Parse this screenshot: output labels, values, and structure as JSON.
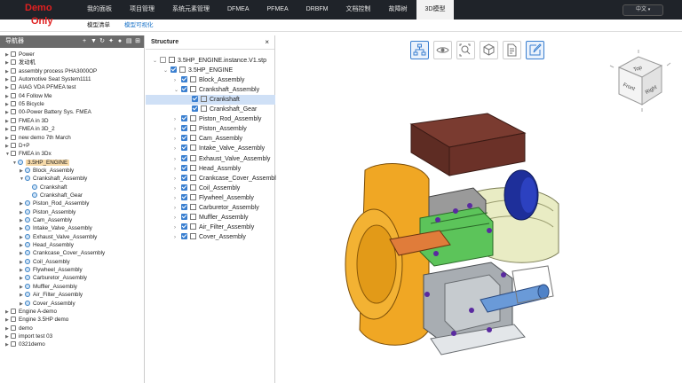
{
  "watermark": {
    "line1": "Demo",
    "line2": "Only"
  },
  "nav": [
    "我的面板",
    "项目管理",
    "系统元素管理",
    "DFMEA",
    "PFMEA",
    "DRBFM",
    "文档控制",
    "故障树",
    "3D模型"
  ],
  "language": "中文",
  "subtabs": [
    "模型清单",
    "模型可视化"
  ],
  "navigator": {
    "title": "导航器",
    "items": [
      {
        "label": "Power",
        "depth": 0
      },
      {
        "label": "发动机",
        "depth": 0
      },
      {
        "label": "assembly process PHA3000OP",
        "depth": 0
      },
      {
        "label": "Automotive Seat System1111",
        "depth": 0
      },
      {
        "label": "AIAG VDA PFMEA test",
        "depth": 0
      },
      {
        "label": "04 Follow Me",
        "depth": 0
      },
      {
        "label": "05 Bicycle",
        "depth": 0
      },
      {
        "label": "00-Power Battery Sys. FMEA",
        "depth": 0
      },
      {
        "label": "FMEA in 3D",
        "depth": 0
      },
      {
        "label": "FMEA in 3D_2",
        "depth": 0
      },
      {
        "label": "new demo 7th March",
        "depth": 0
      },
      {
        "label": "D+P",
        "depth": 0
      },
      {
        "label": "FMEA in 3Dx",
        "depth": 0
      },
      {
        "label": "3.5HP_ENGINE",
        "depth": 1
      },
      {
        "label": "Block_Assembly",
        "depth": 2
      },
      {
        "label": "Crankshaft_Assembly",
        "depth": 2
      },
      {
        "label": "Crankshaft",
        "depth": 3
      },
      {
        "label": "Crankshaft_Gear",
        "depth": 3
      },
      {
        "label": "Piston_Rod_Assembly",
        "depth": 2
      },
      {
        "label": "Piston_Assembly",
        "depth": 2
      },
      {
        "label": "Cam_Assembly",
        "depth": 2
      },
      {
        "label": "Intake_Valve_Assembly",
        "depth": 2
      },
      {
        "label": "Exhaust_Valve_Assembly",
        "depth": 2
      },
      {
        "label": "Head_Assembly",
        "depth": 2
      },
      {
        "label": "Crankcase_Cover_Assembly",
        "depth": 2
      },
      {
        "label": "Coil_Assembly",
        "depth": 2
      },
      {
        "label": "Flywheel_Assembly",
        "depth": 2
      },
      {
        "label": "Carburetor_Assembly",
        "depth": 2
      },
      {
        "label": "Muffler_Assembly",
        "depth": 2
      },
      {
        "label": "Air_Filter_Assembly",
        "depth": 2
      },
      {
        "label": "Cover_Assembly",
        "depth": 2
      },
      {
        "label": "Engine A-demo",
        "depth": 0
      },
      {
        "label": "Engine 3.5HP demo",
        "depth": 0
      },
      {
        "label": "demo",
        "depth": 0
      },
      {
        "label": "import test 03",
        "depth": 0
      },
      {
        "label": "0321demo",
        "depth": 0
      }
    ]
  },
  "structure": {
    "title": "Structure",
    "close": "×",
    "items": [
      {
        "label": "3.5HP_ENGINE.instance.V1.stp",
        "depth": 0
      },
      {
        "label": "3.5HP_ENGINE",
        "depth": 1
      },
      {
        "label": "Block_Assembly",
        "depth": 2
      },
      {
        "label": "Crankshaft_Assembly",
        "depth": 2
      },
      {
        "label": "Crankshaft",
        "depth": 3
      },
      {
        "label": "Crankshaft_Gear",
        "depth": 3
      },
      {
        "label": "Piston_Rod_Assembly",
        "depth": 2
      },
      {
        "label": "Piston_Assembly",
        "depth": 2
      },
      {
        "label": "Cam_Assembly",
        "depth": 2
      },
      {
        "label": "Intake_Valve_Assembly",
        "depth": 2
      },
      {
        "label": "Exhaust_Valve_Assembly",
        "depth": 2
      },
      {
        "label": "Head_Assmbly",
        "depth": 2
      },
      {
        "label": "Crankcase_Cover_Assembly",
        "depth": 2
      },
      {
        "label": "Coil_Assembly",
        "depth": 2
      },
      {
        "label": "Flywheel_Assembly",
        "depth": 2
      },
      {
        "label": "Carburetor_Assembly",
        "depth": 2
      },
      {
        "label": "Muffler_Assembly",
        "depth": 2
      },
      {
        "label": "Air_Filter_Assembly",
        "depth": 2
      },
      {
        "label": "Cover_Assembly",
        "depth": 2
      }
    ]
  },
  "viewcube": {
    "top": "Top",
    "front": "Front",
    "right": "Right"
  },
  "tools": [
    "structure-tree-icon",
    "eye-icon",
    "zoom-fit-icon",
    "cube-icon",
    "document-icon",
    "edit-icon"
  ],
  "colors": {
    "accent": "#3a7fd0",
    "topbar": "#1f2329",
    "selected": "#f6d9a8",
    "highlight": "#cfe0f6"
  }
}
